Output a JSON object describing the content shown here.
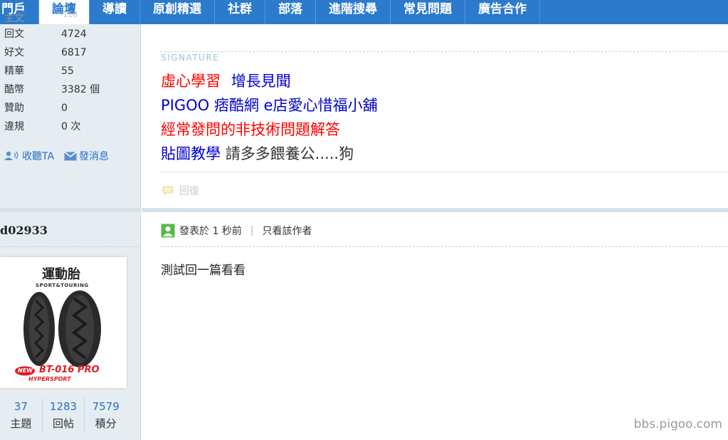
{
  "nav": {
    "items": [
      {
        "label": "門戶",
        "active": false
      },
      {
        "label": "論壇",
        "active": true,
        "sub": "110"
      },
      {
        "label": "導讀",
        "active": false
      },
      {
        "label": "原創精選",
        "active": false
      },
      {
        "label": "社群",
        "active": false
      },
      {
        "label": "部落",
        "active": false
      },
      {
        "label": "進階搜尋",
        "active": false
      },
      {
        "label": "常見問題",
        "active": false
      },
      {
        "label": "廣告合作",
        "active": false
      }
    ]
  },
  "sidebar": {
    "partial_top": "主文",
    "stats": [
      {
        "label": "回文",
        "value": "4724"
      },
      {
        "label": "好文",
        "value": "6817"
      },
      {
        "label": "精華",
        "value": "55"
      },
      {
        "label": "酷幣",
        "value": "3382 個"
      },
      {
        "label": "贊助",
        "value": "0"
      },
      {
        "label": "違規",
        "value": "0 次"
      }
    ],
    "follow_label": "收聽TA",
    "message_label": "發消息",
    "author": "d02933",
    "avatar": {
      "title": "運動胎",
      "subtitle": "SPORT&TOURING",
      "model": "BT-016 PRO",
      "tagline": "HYPERSPORT",
      "new_badge": "NEW"
    },
    "counts": [
      {
        "num": "37",
        "label": "主題"
      },
      {
        "num": "1283",
        "label": "回帖"
      },
      {
        "num": "7579",
        "label": "積分"
      }
    ]
  },
  "signature": {
    "title": "SIGNATURE",
    "line1a": "虛心學習",
    "line1b": "增長見聞",
    "line2": "PIGOO 痞酷網 e店愛心惜福小舖",
    "line3": "經常發問的非技術問題解答",
    "line4a": "貼圖教學",
    "line4b": "請多多餵養公.....狗"
  },
  "reply_label": "回復",
  "post": {
    "posted": "發表於 1 秒前",
    "only_author": "只看該作者",
    "body": "測試回一篇看看"
  },
  "watermark": "bbs.pigoo.com",
  "colors": {
    "nav_bg": "#2b7acb",
    "sidebar_bg": "#e5edf2",
    "link_blue": "#2b6dc1",
    "sig_red": "#ff0000",
    "sig_blue": "#0000cc"
  }
}
